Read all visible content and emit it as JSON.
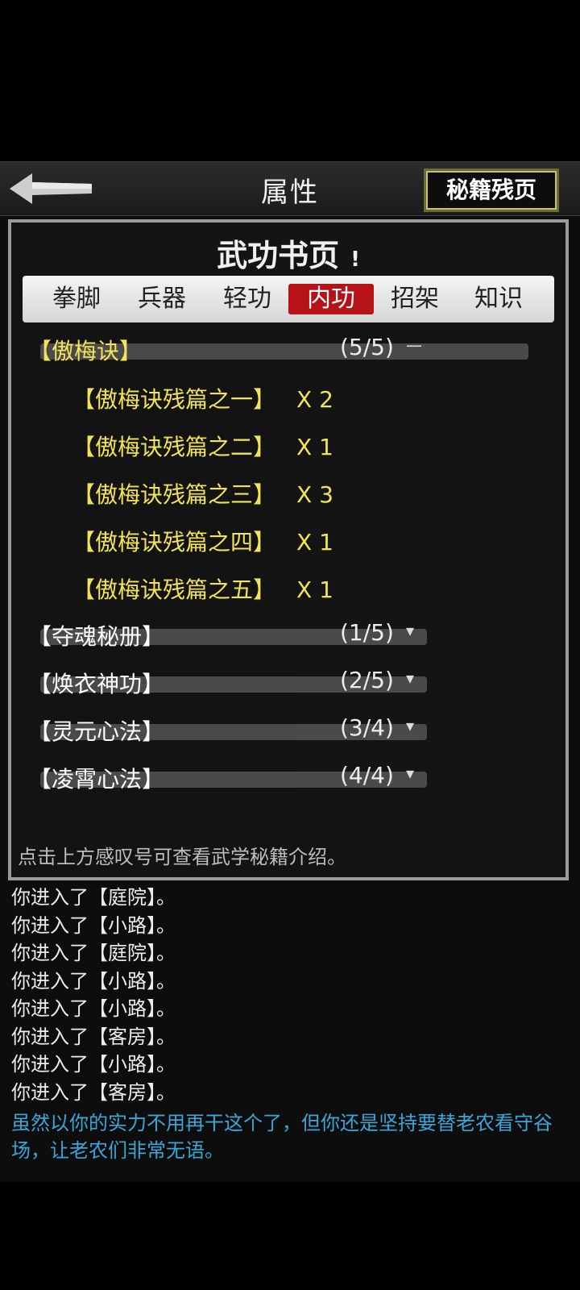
{
  "header": {
    "title": "属性",
    "right_button": "秘籍残页"
  },
  "panel": {
    "title": "武功书页",
    "info_mark": "!",
    "tabs": [
      {
        "label": "拳脚",
        "active": false
      },
      {
        "label": "兵器",
        "active": false
      },
      {
        "label": "轻功",
        "active": false
      },
      {
        "label": "内功",
        "active": true
      },
      {
        "label": "招架",
        "active": false
      },
      {
        "label": "知识",
        "active": false
      }
    ],
    "groups": [
      {
        "name": "【傲梅诀】",
        "count": "(5/5)",
        "toggle": "—",
        "expanded": true,
        "items": [
          {
            "name": "【傲梅诀残篇之一】",
            "qty": "X 2"
          },
          {
            "name": "【傲梅诀残篇之二】",
            "qty": "X 1"
          },
          {
            "name": "【傲梅诀残篇之三】",
            "qty": "X 3"
          },
          {
            "name": "【傲梅诀残篇之四】",
            "qty": "X 1"
          },
          {
            "name": "【傲梅诀残篇之五】",
            "qty": "X 1"
          }
        ]
      },
      {
        "name": "【夺魂秘册】",
        "count": "(1/5)",
        "toggle": "▾",
        "expanded": false
      },
      {
        "name": "【焕衣神功】",
        "count": "(2/5)",
        "toggle": "▾",
        "expanded": false
      },
      {
        "name": "【灵元心法】",
        "count": "(3/4)",
        "toggle": "▾",
        "expanded": false
      },
      {
        "name": "【凌霄心法】",
        "count": "(4/4)",
        "toggle": "▾",
        "expanded": false
      }
    ],
    "hint": "点击上方感叹号可查看武学秘籍介绍。"
  },
  "log": [
    "你进入了【庭院】。",
    "你进入了【小路】。",
    "你进入了【庭院】。",
    "你进入了【小路】。",
    "你进入了【小路】。",
    "你进入了【客房】。",
    "你进入了【小路】。",
    "你进入了【客房】。"
  ],
  "story": "虽然以你的实力不用再干这个了，但你还是坚持要替老农看守谷场，让老农们非常无语。",
  "colors": {
    "accent_red": "#b71217",
    "gold": "#f2e35a",
    "story_blue": "#3aa6d8"
  }
}
